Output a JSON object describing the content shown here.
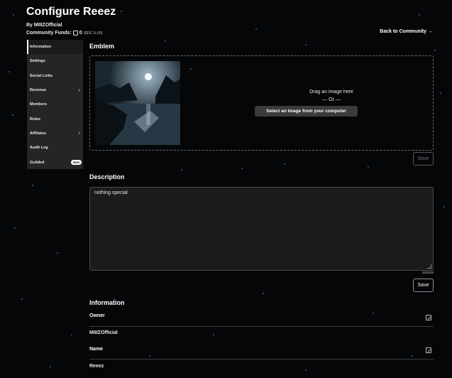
{
  "header": {
    "title": "Configure Reeez",
    "byline": "By MIIIZOfficial",
    "funds_label": "Community Funds:",
    "funds_value": "0",
    "funds_sub": "($DC 0.00)",
    "back_link": "Back to Community"
  },
  "sidebar": {
    "items": [
      {
        "label": "Information"
      },
      {
        "label": "Settings"
      },
      {
        "label": "Social Links"
      },
      {
        "label": "Revenue"
      },
      {
        "label": "Members"
      },
      {
        "label": "Roles"
      },
      {
        "label": "Affiliates"
      },
      {
        "label": "Audit Log"
      },
      {
        "label": "Guilded",
        "badge": "New"
      }
    ]
  },
  "emblem": {
    "title": "Emblem",
    "drag_text": "Drag an image here",
    "or_text": "— Or —",
    "select_button": "Select an image from your computer",
    "save_label": "Save"
  },
  "description": {
    "title": "Description",
    "value": "nothing special",
    "char_count": "15/1000",
    "save_label": "Save"
  },
  "information": {
    "title": "Information",
    "owner_label": "Owner",
    "owner_value": "MIIIZOfficial",
    "name_label": "Name",
    "name_value": "Reeez"
  },
  "colors": {
    "background": "#050608",
    "sidebar": "#232527",
    "text": "#e8e9ea",
    "accent_stars": "#5a7bd6"
  }
}
